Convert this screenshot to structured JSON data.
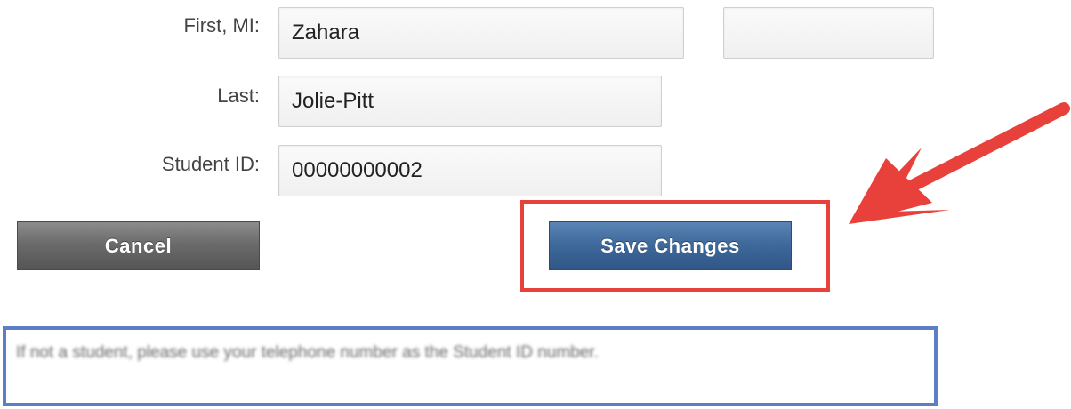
{
  "form": {
    "first_label": "First, MI:",
    "first_value": "Zahara",
    "mi_value": "",
    "last_label": "Last:",
    "last_value": "Jolie-Pitt",
    "student_id_label": "Student ID:",
    "student_id_value": "00000000002"
  },
  "actions": {
    "cancel_label": "Cancel",
    "save_label": "Save Changes"
  },
  "note": {
    "text": "If not a student, please use your telephone number as the Student ID number",
    "end": "."
  },
  "annotations": {
    "arrow_color": "#e8413c",
    "red_box_color": "#e8413c",
    "blue_box_color": "#5b7ec5"
  }
}
